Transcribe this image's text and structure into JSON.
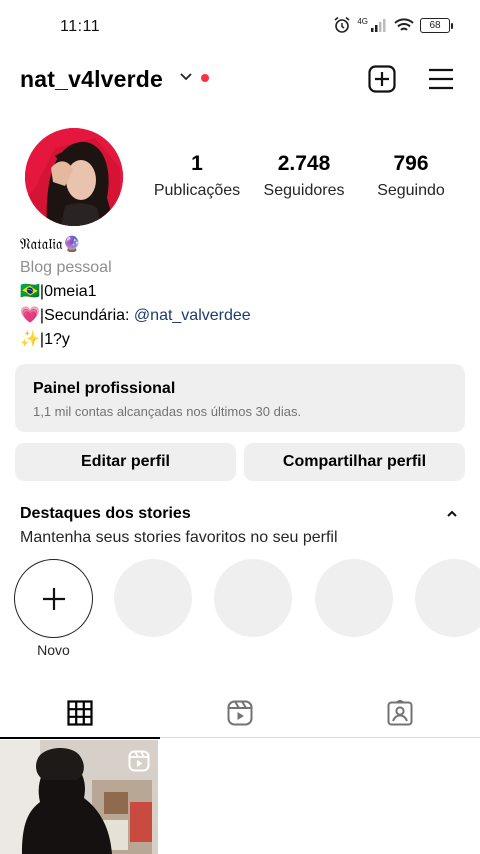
{
  "status_bar": {
    "time": "11:11",
    "network": "4G",
    "battery": "68"
  },
  "header": {
    "username": "nat_v4lverde"
  },
  "profile": {
    "stats": [
      {
        "value": "1",
        "label": "Publicações"
      },
      {
        "value": "2.748",
        "label": "Seguidores"
      },
      {
        "value": "796",
        "label": "Seguindo"
      }
    ]
  },
  "bio": {
    "name": "𝔑𝔞𝔱𝔞𝔩𝔦𝔞🔮",
    "category": "Blog pessoal",
    "line1": "🇧🇷|0meia1",
    "line2_prefix": "💗|Secundária: ",
    "line2_link": "@nat_valverdee",
    "line3": "✨|1?y"
  },
  "pro_panel": {
    "title": "Painel profissional",
    "subtitle": "1,1 mil contas alcançadas nos últimos 30 dias."
  },
  "buttons": {
    "edit": "Editar perfil",
    "share": "Compartilhar perfil"
  },
  "highlights": {
    "title": "Destaques dos stories",
    "subtitle": "Mantenha seus stories favoritos no seu perfil",
    "new_label": "Novo"
  },
  "tabs": [
    "grid-icon",
    "reels-icon",
    "tagged-icon"
  ],
  "colors": {
    "accent_dot": "#ff3040",
    "link": "#1e3a6e",
    "panel_bg": "#efefef"
  }
}
